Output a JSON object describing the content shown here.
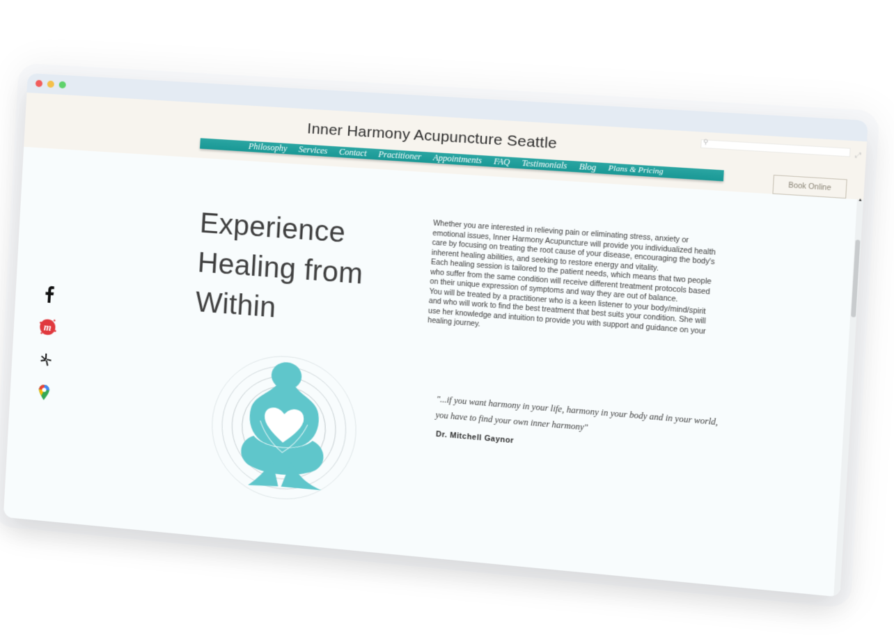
{
  "site": {
    "title": "Inner Harmony Acupuncture Seattle",
    "book_button": "Book Online"
  },
  "nav": {
    "items": [
      "Philosophy",
      "Services",
      "Contact",
      "Practitioner",
      "Appointments",
      "FAQ",
      "Testimonials",
      "Blog",
      "Plans & Pricing"
    ]
  },
  "social": {
    "icons": [
      "facebook-icon",
      "meetup-icon",
      "yelp-icon",
      "google-maps-icon"
    ]
  },
  "main": {
    "headline_1": "Experience",
    "headline_2": "Healing from",
    "headline_3": "Within",
    "paragraph_1": "Whether you are interested in relieving pain or eliminating stress, anxiety or emotional issues, Inner Harmony Acupuncture will provide you individualized health care by focusing on treating the root cause of your disease, encouraging the body's inherent healing abilities, and seeking to restore energy and vitality.",
    "paragraph_2": "Each healing session is tailored to the patient needs, which means that two people who suffer from the same condition will receive different treatment protocols based on their unique expression of symptoms and way they are out of balance.",
    "paragraph_3": "You will be treated by a practitioner who is a keen listener to your body/mind/spirit and who will work to find the best treatment that best suits your condition. She will use her knowledge and intuition to provide you with support and guidance on your healing journey.",
    "quote": "\"...if you want harmony in your life, harmony in your body and in your world, you have to find your own inner harmony\"",
    "quote_author": "Dr. Mitchell Gaynor"
  },
  "colors": {
    "nav_teal": "#1f9f9c",
    "logo_teal": "#5fc6cb",
    "header_bg": "#f7f4ee",
    "content_bg": "#f8fcfd",
    "meetup_red": "#e0393e"
  }
}
